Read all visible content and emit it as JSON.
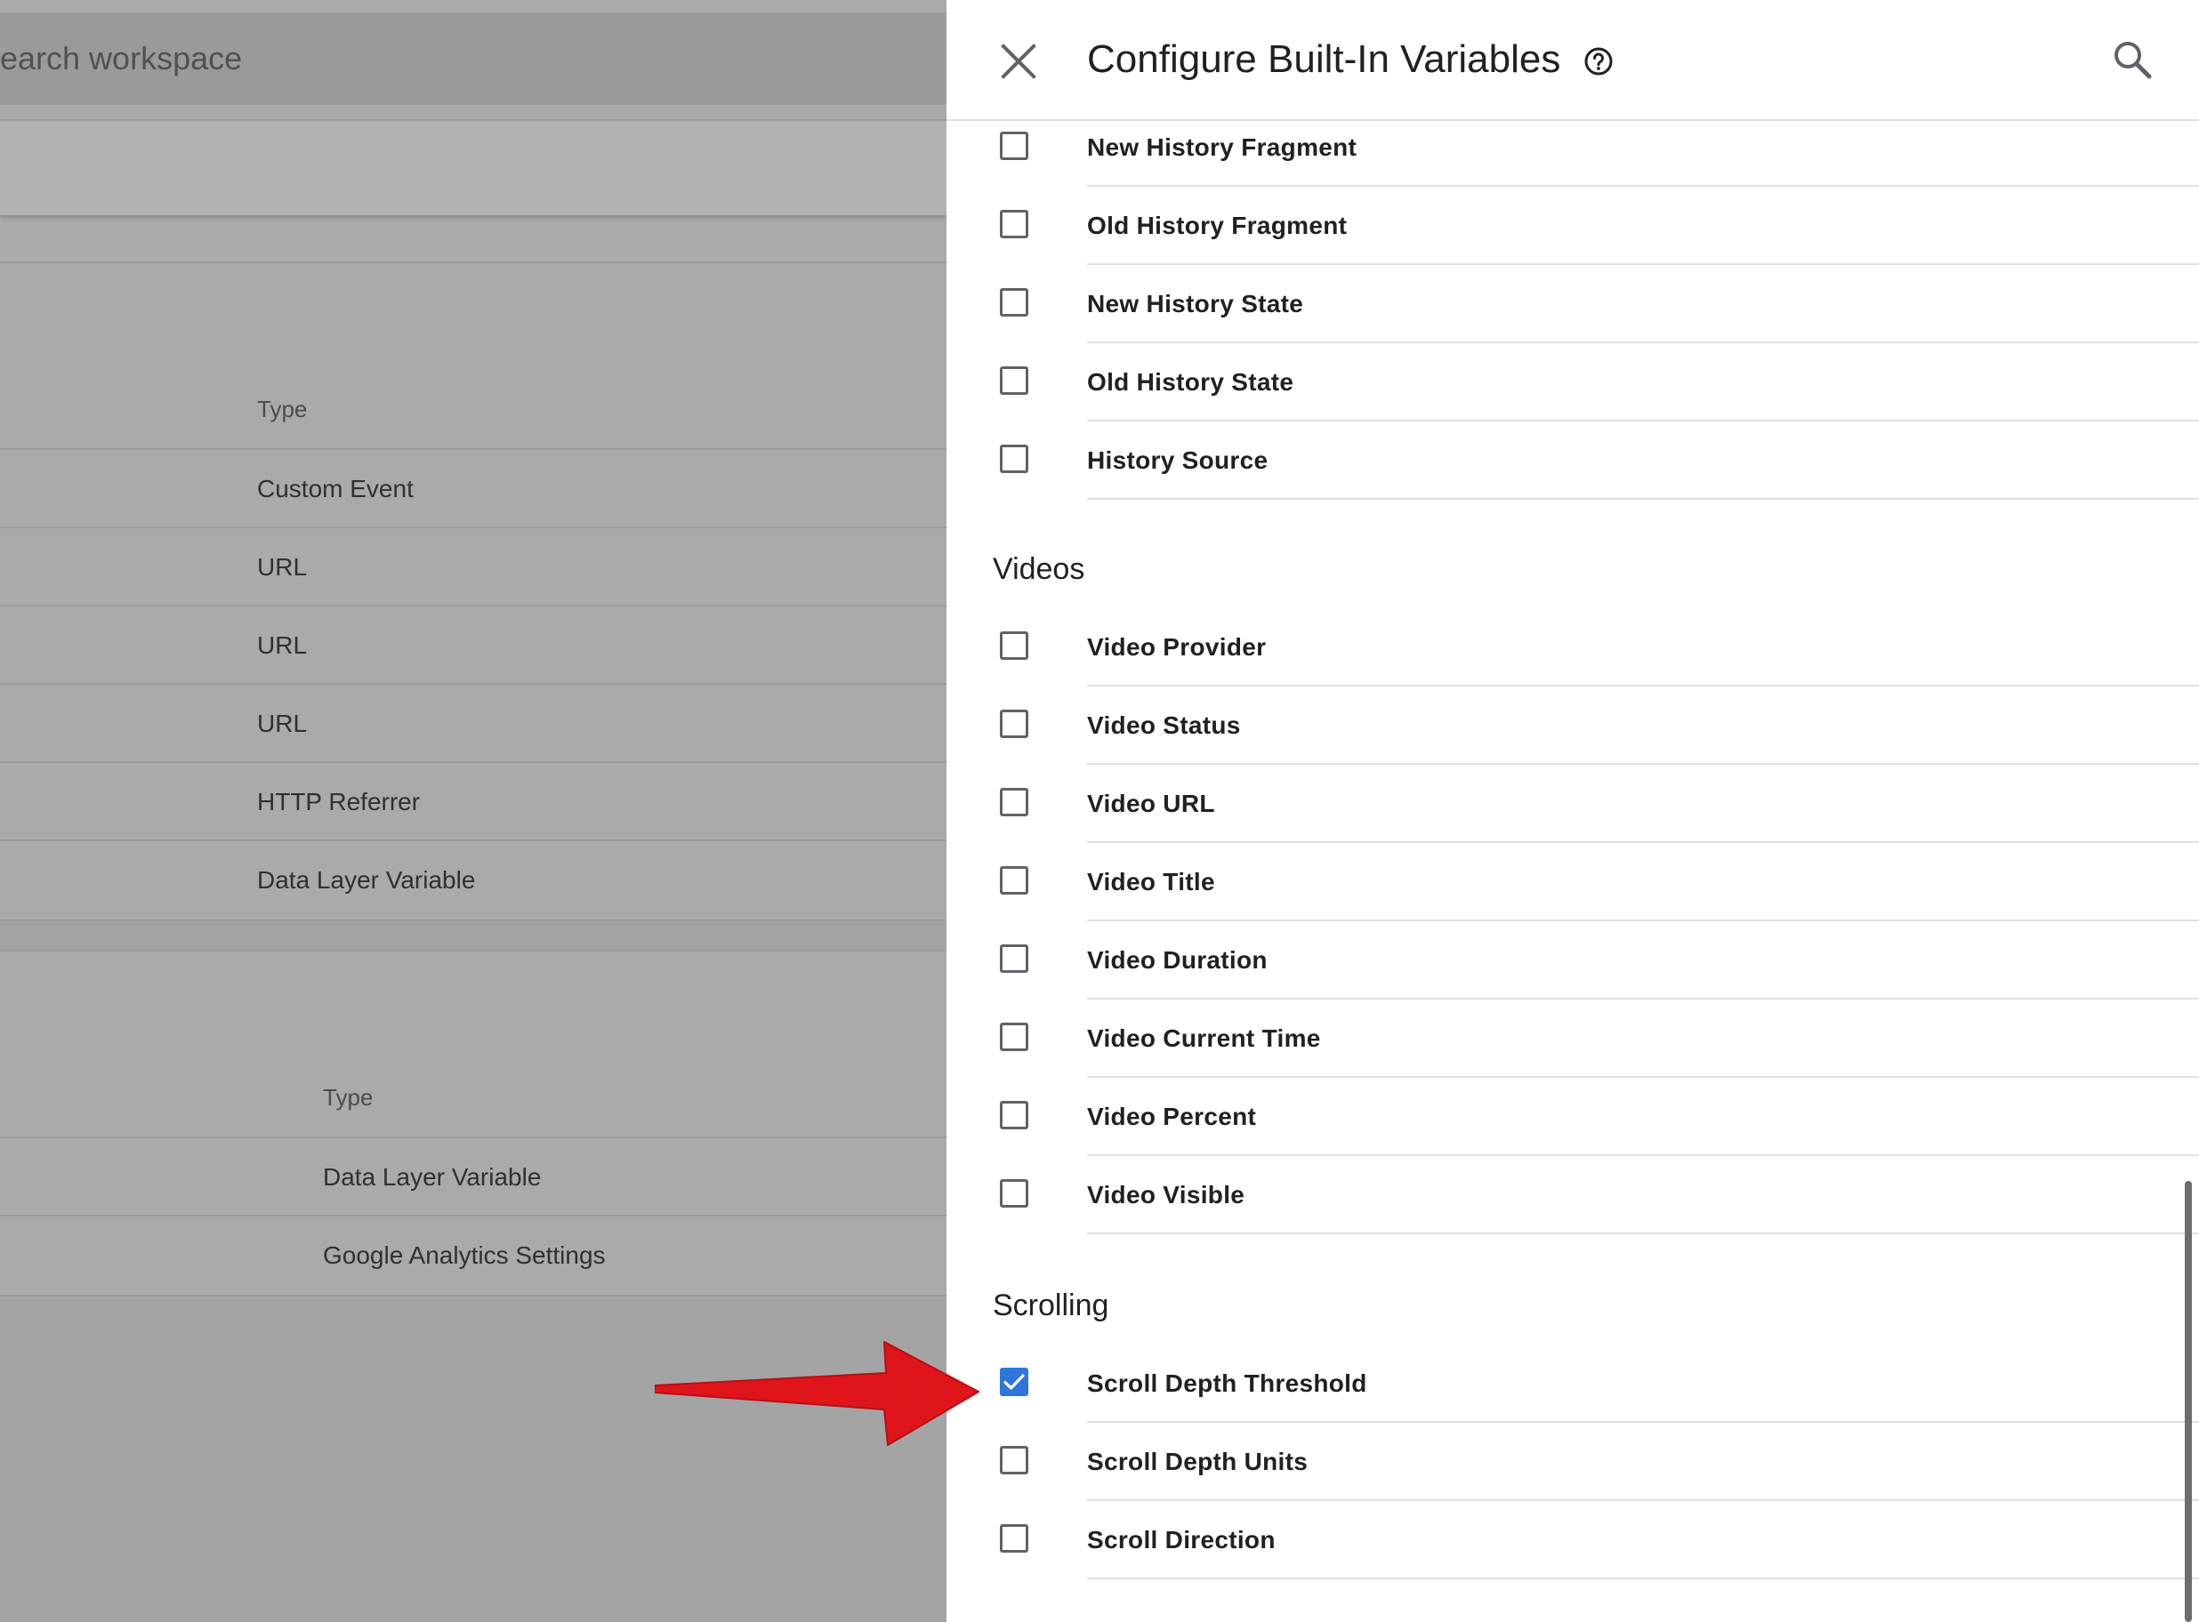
{
  "background": {
    "search_placeholder": "earch workspace",
    "table1": {
      "header": "Type",
      "rows": [
        "Custom Event",
        "URL",
        "URL",
        "URL",
        "HTTP Referrer",
        "Data Layer Variable"
      ]
    },
    "table2": {
      "header": "Type",
      "rows": [
        "Data Layer Variable",
        "Google Analytics Settings"
      ]
    }
  },
  "panel": {
    "title": "Configure Built-In Variables",
    "icons": {
      "close": "close-icon",
      "help": "help-circle-icon",
      "search": "search-icon"
    },
    "history_items": [
      {
        "label": "New History Fragment",
        "checked": false
      },
      {
        "label": "Old History Fragment",
        "checked": false
      },
      {
        "label": "New History State",
        "checked": false
      },
      {
        "label": "Old History State",
        "checked": false
      },
      {
        "label": "History Source",
        "checked": false
      }
    ],
    "videos": {
      "title": "Videos",
      "items": [
        {
          "label": "Video Provider",
          "checked": false
        },
        {
          "label": "Video Status",
          "checked": false
        },
        {
          "label": "Video URL",
          "checked": false
        },
        {
          "label": "Video Title",
          "checked": false
        },
        {
          "label": "Video Duration",
          "checked": false
        },
        {
          "label": "Video Current Time",
          "checked": false
        },
        {
          "label": "Video Percent",
          "checked": false
        },
        {
          "label": "Video Visible",
          "checked": false
        }
      ]
    },
    "scrolling": {
      "title": "Scrolling",
      "items": [
        {
          "label": "Scroll Depth Threshold",
          "checked": true
        },
        {
          "label": "Scroll Depth Units",
          "checked": false
        },
        {
          "label": "Scroll Direction",
          "checked": false
        }
      ]
    }
  },
  "colors": {
    "checkbox_checked": "#2f76d9",
    "annotation_arrow": "#e0141b",
    "overlay": "#aaaaaa"
  }
}
